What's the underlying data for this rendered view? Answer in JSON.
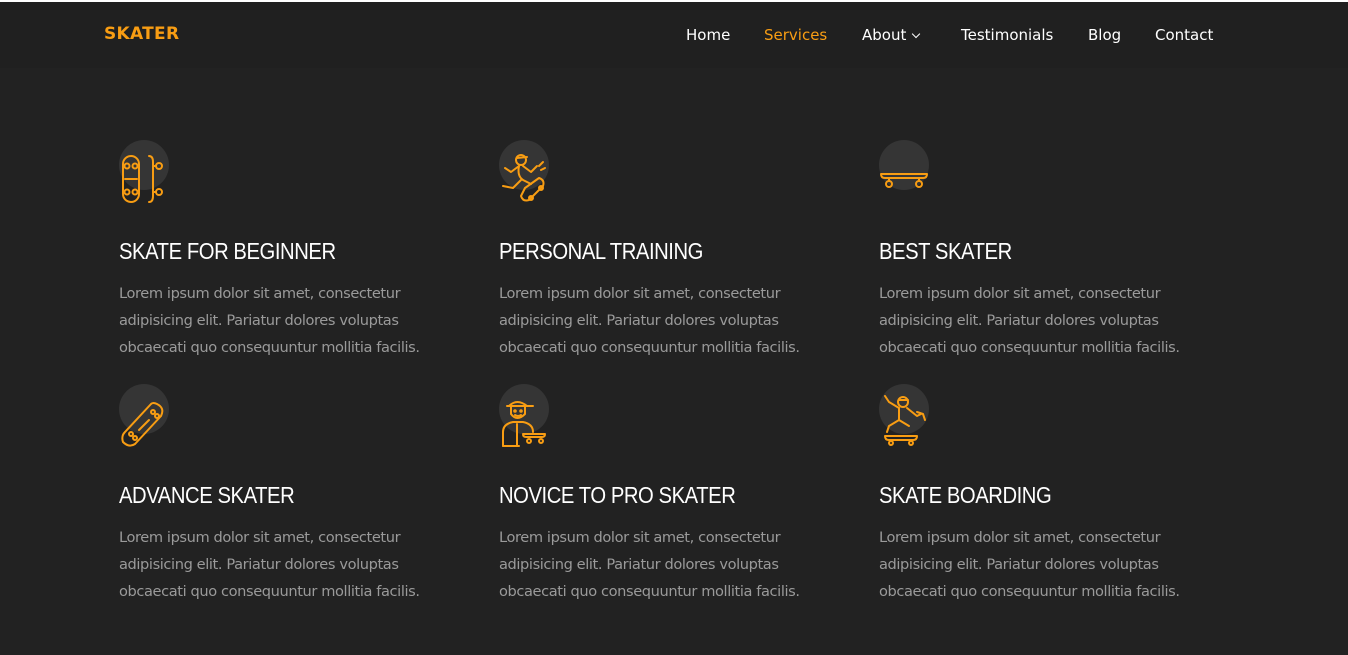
{
  "brand": "SKATER",
  "nav": [
    {
      "label": "Home",
      "active": false
    },
    {
      "label": "Services",
      "active": true
    },
    {
      "label": "About",
      "active": false,
      "dropdown": true
    },
    {
      "label": "Testimonials",
      "active": false
    },
    {
      "label": "Blog",
      "active": false
    },
    {
      "label": "Contact",
      "active": false
    }
  ],
  "accent_color": "#f89d13",
  "services": [
    {
      "icon": "skateboard-top-and-side-icon",
      "title": "SKATE FOR BEGINNER",
      "text": "Lorem ipsum dolor sit amet, consectetur adipisicing elit. Pariatur dolores voluptas obcaecati quo consequuntur mollitia facilis."
    },
    {
      "icon": "skater-jumping-icon",
      "title": "PERSONAL TRAINING",
      "text": "Lorem ipsum dolor sit amet, consectetur adipisicing elit. Pariatur dolores voluptas obcaecati quo consequuntur mollitia facilis."
    },
    {
      "icon": "skateboard-side-icon",
      "title": "BEST SKATER",
      "text": "Lorem ipsum dolor sit amet, consectetur adipisicing elit. Pariatur dolores voluptas obcaecati quo consequuntur mollitia facilis."
    },
    {
      "icon": "skateboard-diagonal-icon",
      "title": "ADVANCE SKATER",
      "text": "Lorem ipsum dolor sit amet, consectetur adipisicing elit. Pariatur dolores voluptas obcaecati quo consequuntur mollitia facilis."
    },
    {
      "icon": "skater-with-cap-icon",
      "title": "NOVICE TO PRO SKATER",
      "text": "Lorem ipsum dolor sit amet, consectetur adipisicing elit. Pariatur dolores voluptas obcaecati quo consequuntur mollitia facilis."
    },
    {
      "icon": "skater-trick-icon",
      "title": "SKATE BOARDING",
      "text": "Lorem ipsum dolor sit amet, consectetur adipisicing elit. Pariatur dolores voluptas obcaecati quo consequuntur mollitia facilis."
    }
  ]
}
